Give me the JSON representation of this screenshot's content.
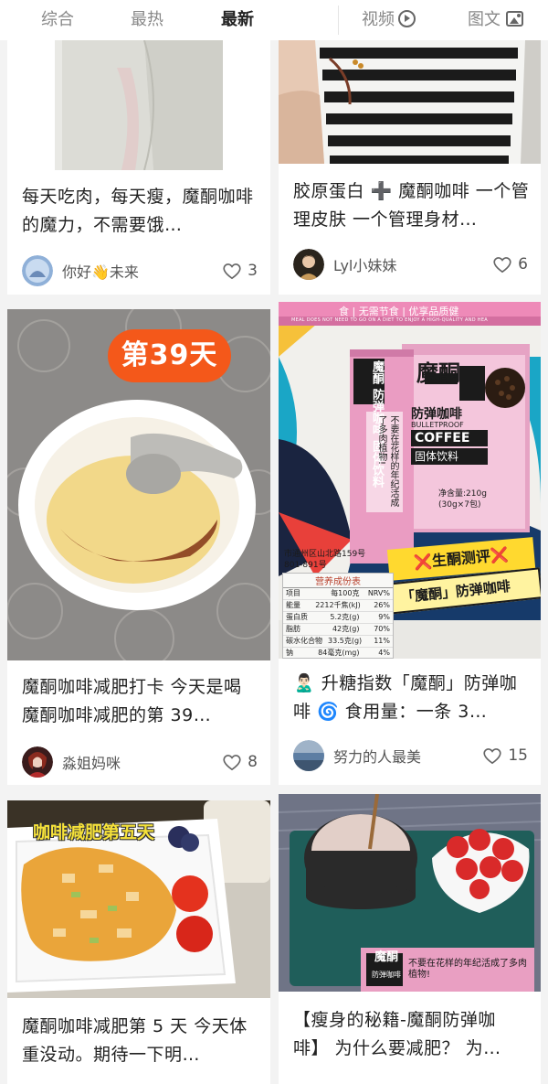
{
  "tabs": [
    "综合",
    "最热",
    "最新"
  ],
  "media_tabs": {
    "video": "视频",
    "image_text": "图文"
  },
  "icons": {
    "video": "play-circle-icon",
    "image_text": "image-icon",
    "like": "heart-outline-icon"
  },
  "cards": [
    {
      "title": "每天吃肉，每天瘦，魔酮咖啡的魔力，不需要饿…",
      "author": "你好👋未来",
      "likes": "3"
    },
    {
      "title": "胶原蛋白 ➕ 魔酮咖啡 一个管理皮肤 一个管理身材…",
      "author": "Lyl小妹妹",
      "likes": "6"
    },
    {
      "title": "魔酮咖啡减肥打卡 今天是喝魔酮咖啡减肥的第 39…",
      "author": "淼姐妈咪",
      "likes": "8",
      "image_text": {
        "badge": "第39天"
      }
    },
    {
      "title": "🙎🏻‍♂️ 升糖指数「魔酮」防弹咖啡 🌀 食用量：一条 3…",
      "author": "努力的人最美",
      "likes": "15",
      "image_text": {
        "top_banner": "食 | 无需节食 | 优享品质健",
        "top_banner_small": "MEAL DOES NOT NEED TO GO ON A DIET TO ENJOY A HIGH-QUALITY AND HEA",
        "box_brand": "魔酮",
        "box_product": "防弹咖啡",
        "box_en1": "BULLETPROOF",
        "box_en2": "COFFEE",
        "box_type": "固体饮料",
        "box_net": "净含量:210g",
        "box_pack": "(30g×7包)",
        "sachet_slogan": "不要在花样的年纪活成了多肉植物!",
        "sachet_side": "魔酮 防弹咖啡 固体饮料",
        "review1": "❌生酮测评❌",
        "review2": "「魔酮」防弹咖啡",
        "address": "市通州区山北路159号",
        "phone": "801-891号",
        "nutrition_title": "营养成份表",
        "nutrition_header": [
          "项目",
          "每100克",
          "NRV%"
        ],
        "nutrition_rows": [
          [
            "能量",
            "2212千焦(kJ)",
            "26%"
          ],
          [
            "蛋白质",
            "5.2克(g)",
            "9%"
          ],
          [
            "脂肪",
            "42克(g)",
            "70%"
          ],
          [
            "碳水化合物",
            "33.5克(g)",
            "11%"
          ],
          [
            "钠",
            "84毫克(mg)",
            "4%"
          ]
        ]
      }
    },
    {
      "title": "魔酮咖啡减肥第 5 天 今天体重没动。期待一下明…",
      "author": "",
      "likes": "",
      "image_text": {
        "badge": "咖啡减肥第五天"
      }
    },
    {
      "title": "【瘦身的秘籍-魔酮防弹咖啡】 为什么要减肥？ 为…",
      "author": "",
      "likes": "",
      "image_text": {
        "sachet_brand": "魔酮",
        "sachet_product": "防弹咖啡",
        "sachet_slogan": "不要在花样的年纪活成了多肉植物!"
      }
    }
  ],
  "colors": {
    "background": "#f3f3f3",
    "card": "#ffffff",
    "text": "#222222",
    "muted": "#888888",
    "badge_orange": "#f4581a",
    "product_pink": "#e9a8c8"
  }
}
